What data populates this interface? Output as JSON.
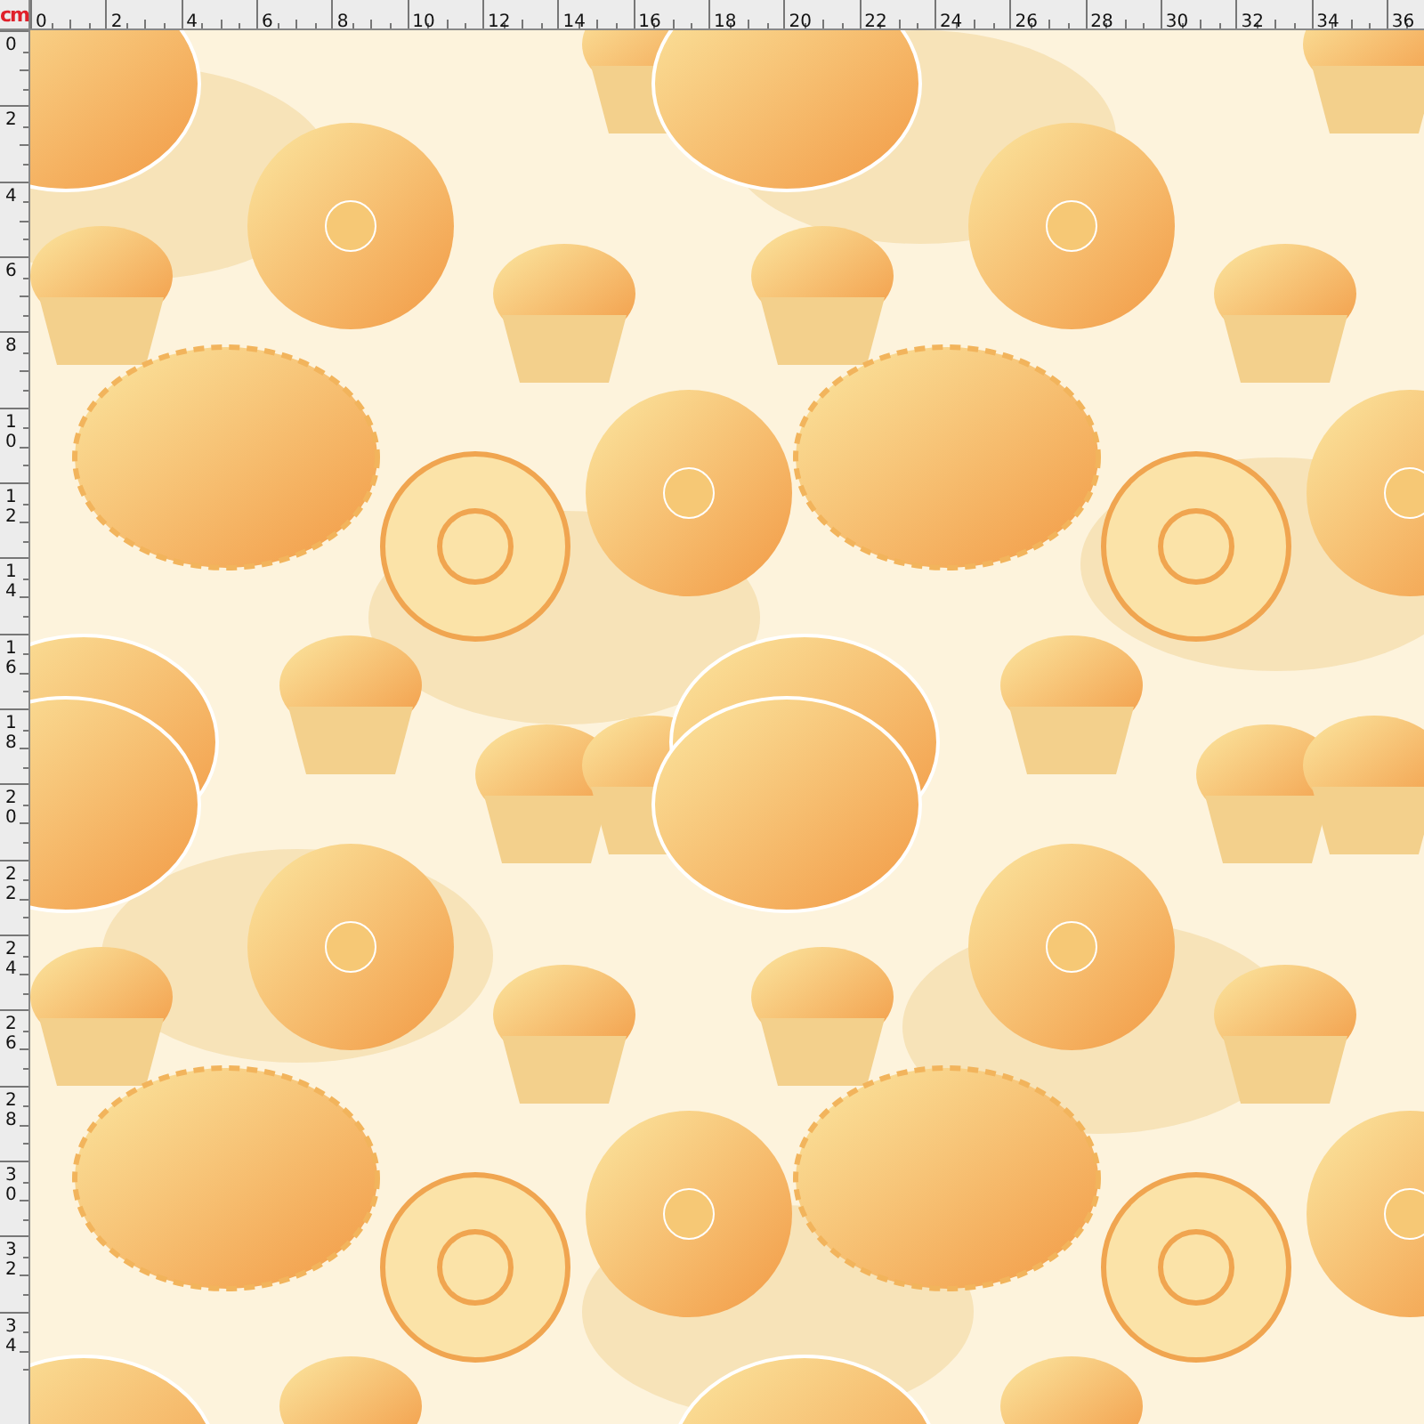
{
  "ruler": {
    "unit": "cm",
    "top_labels": [
      "0",
      "2",
      "4",
      "6",
      "8",
      "10",
      "12",
      "14",
      "16",
      "18",
      "20",
      "22",
      "24",
      "26",
      "28",
      "30",
      "32",
      "34",
      "36"
    ],
    "left_labels": [
      "0",
      "2",
      "4",
      "6",
      "8",
      "10",
      "12",
      "14",
      "16",
      "18",
      "20",
      "22",
      "24",
      "26",
      "28",
      "30",
      "32",
      "34"
    ]
  }
}
